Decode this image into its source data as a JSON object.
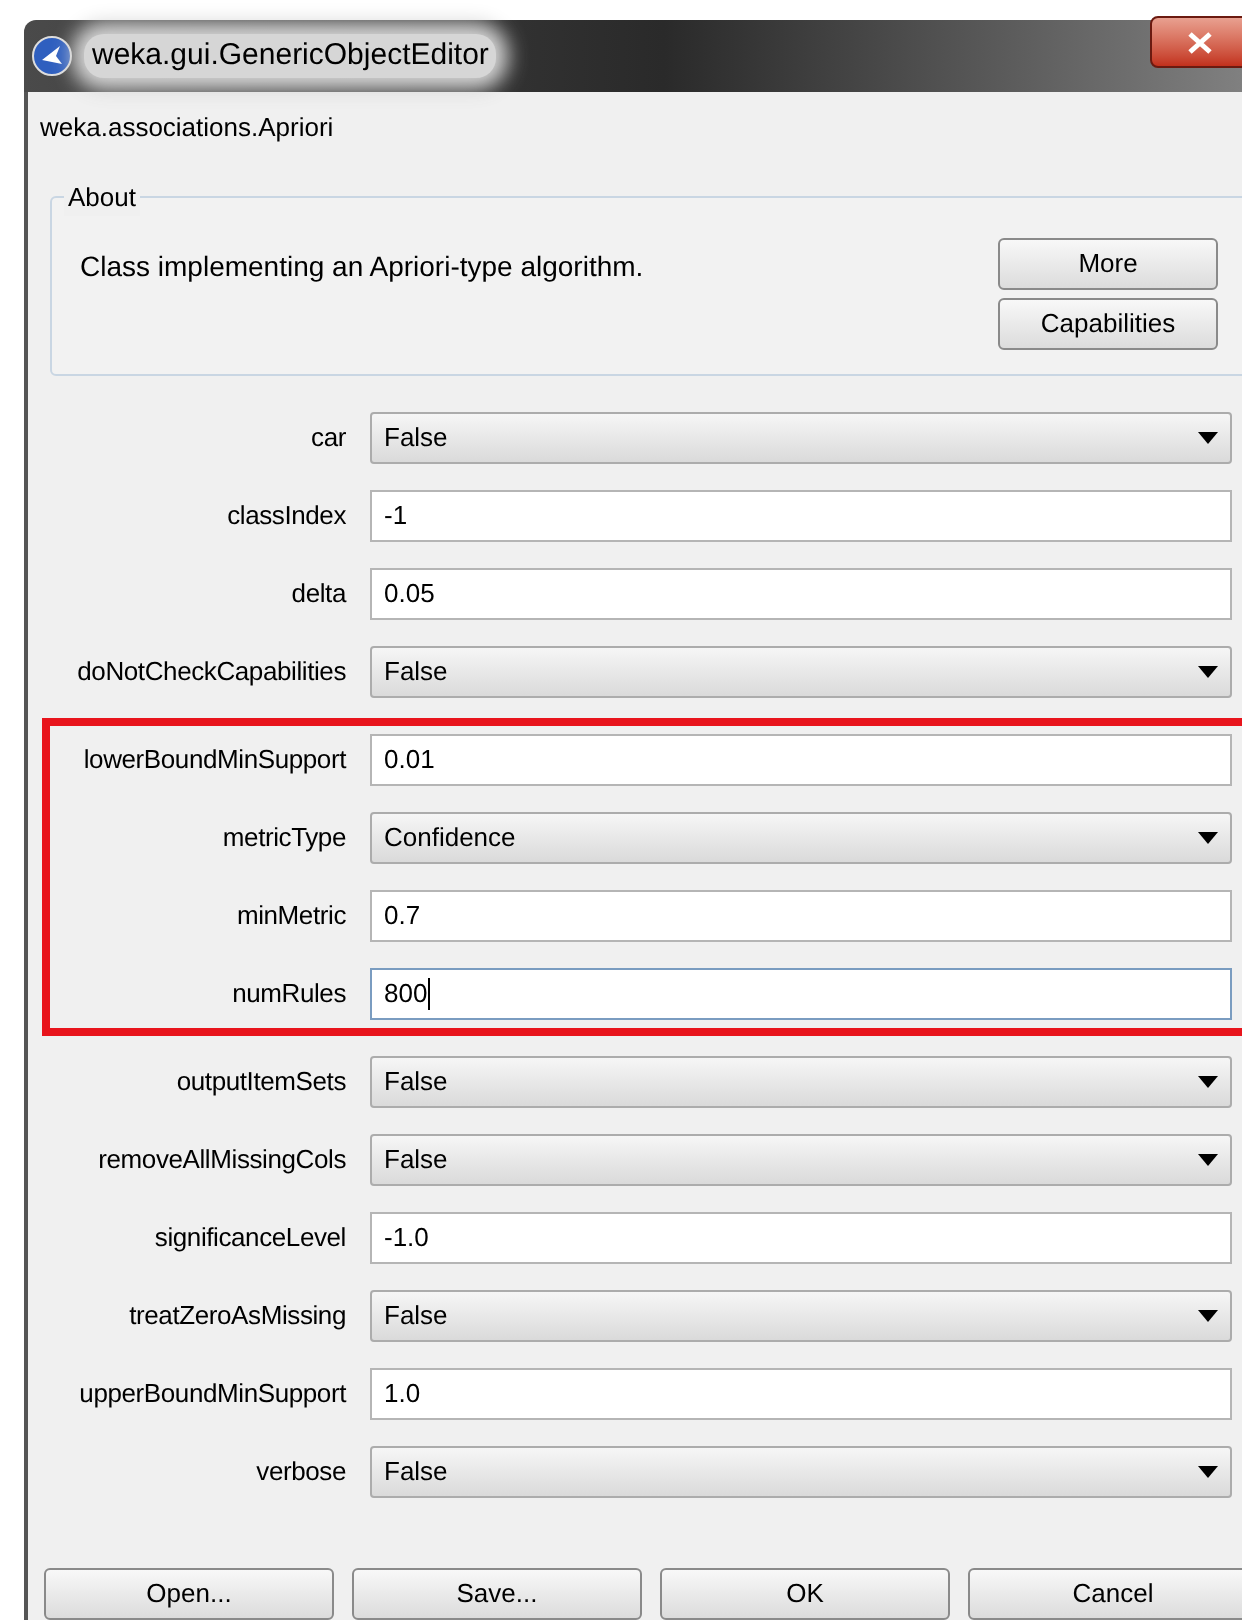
{
  "window": {
    "title": "weka.gui.GenericObjectEditor"
  },
  "class_name": "weka.associations.Apriori",
  "about": {
    "legend": "About",
    "description": "Class implementing an Apriori-type algorithm.",
    "buttons": [
      "More",
      "Capabilities"
    ]
  },
  "property_groups": [
    {
      "highlighted": false,
      "properties": [
        {
          "label": "car",
          "kind": "dropdown",
          "value": "False",
          "focused": false
        },
        {
          "label": "classIndex",
          "kind": "text",
          "value": "-1",
          "focused": false
        },
        {
          "label": "delta",
          "kind": "text",
          "value": "0.05",
          "focused": false
        },
        {
          "label": "doNotCheckCapabilities",
          "kind": "dropdown",
          "value": "False",
          "focused": false
        }
      ]
    },
    {
      "highlighted": true,
      "properties": [
        {
          "label": "lowerBoundMinSupport",
          "kind": "text",
          "value": "0.01",
          "focused": false
        },
        {
          "label": "metricType",
          "kind": "dropdown",
          "value": "Confidence",
          "focused": false
        },
        {
          "label": "minMetric",
          "kind": "text",
          "value": "0.7",
          "focused": false
        },
        {
          "label": "numRules",
          "kind": "text",
          "value": "800",
          "focused": true
        }
      ]
    },
    {
      "highlighted": false,
      "properties": [
        {
          "label": "outputItemSets",
          "kind": "dropdown",
          "value": "False",
          "focused": false
        },
        {
          "label": "removeAllMissingCols",
          "kind": "dropdown",
          "value": "False",
          "focused": false
        },
        {
          "label": "significanceLevel",
          "kind": "text",
          "value": "-1.0",
          "focused": false
        },
        {
          "label": "treatZeroAsMissing",
          "kind": "dropdown",
          "value": "False",
          "focused": false
        },
        {
          "label": "upperBoundMinSupport",
          "kind": "text",
          "value": "1.0",
          "focused": false
        },
        {
          "label": "verbose",
          "kind": "dropdown",
          "value": "False",
          "focused": false
        }
      ]
    }
  ],
  "buttons": [
    "Open...",
    "Save...",
    "OK",
    "Cancel"
  ]
}
